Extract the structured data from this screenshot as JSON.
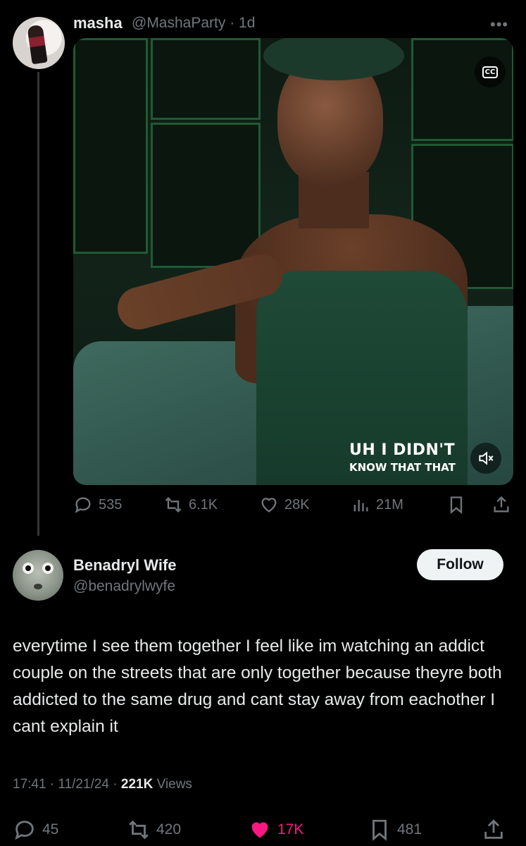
{
  "quoted_tweet": {
    "display_name": "masha",
    "handle_time": "@MashaParty · 1d",
    "more_label": "•••",
    "media": {
      "cc_label": "CC",
      "caption_line1": "UH I DIDN'T",
      "caption_line2": "KNOW THAT THAT"
    },
    "actions": {
      "replies": "535",
      "reposts": "6.1K",
      "likes": "28K",
      "views": "21M"
    }
  },
  "main_tweet": {
    "display_name": "Benadryl Wife",
    "handle": "@benadrylwyfe",
    "follow_label": "Follow",
    "text": "everytime I see them together I feel like im watching an addict couple on the streets that are only together because theyre both addicted to the same drug and cant stay away from eachother I cant explain it",
    "time_date": "17:41 · 11/21/24 · ",
    "views_count": "221K",
    "views_label": " Views",
    "actions": {
      "replies": "45",
      "reposts": "420",
      "likes": "17K",
      "bookmarks": "481"
    }
  },
  "colors": {
    "background": "#000000",
    "text_primary": "#e7e9ea",
    "text_secondary": "#71767b",
    "like_active": "#f91880",
    "thread_line": "#333639"
  }
}
